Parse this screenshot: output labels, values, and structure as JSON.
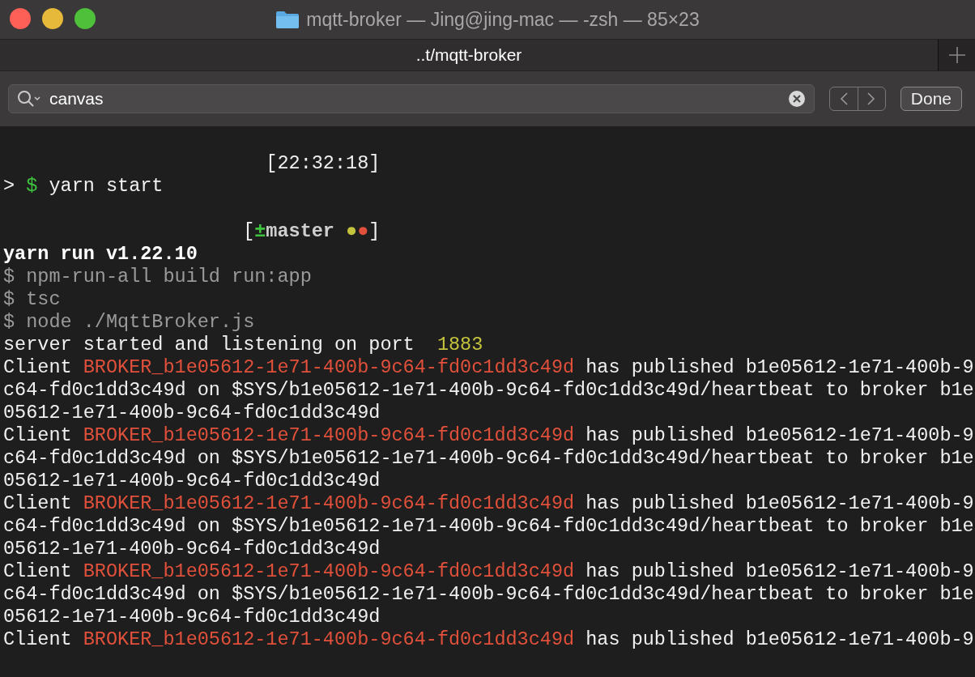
{
  "window": {
    "title": "mqtt-broker — Jing@jing-mac — -zsh — 85×23"
  },
  "tabs": [
    {
      "label": "..t/mqtt-broker",
      "selected": true
    }
  ],
  "find_bar": {
    "value": "canvas",
    "done_label": "Done"
  },
  "terminal_lines": [
    {
      "kind": "blank"
    },
    {
      "kind": "right_prompt",
      "segments": [
        {
          "text": "[22:32:18]",
          "color": "#f0f0f0",
          "bold": false
        }
      ]
    },
    {
      "kind": "line",
      "segments": [
        {
          "text": "> ",
          "color": "#f0f0f0",
          "bold": false
        },
        {
          "text": "$",
          "color": "#3fc43f",
          "bold": false
        },
        {
          "text": " yarn start",
          "color": "#f0f0f0",
          "bold": false
        }
      ]
    },
    {
      "kind": "blank"
    },
    {
      "kind": "git_prompt",
      "segments": [
        {
          "text": "[",
          "color": "#f0f0f0",
          "bold": false
        },
        {
          "text": "±",
          "color": "#3fc43f",
          "bold": true
        },
        {
          "text": "master ",
          "color": "#cfcfcf",
          "bold": true
        },
        {
          "text": "●",
          "color": "#c3c33d"
        },
        {
          "text": "●",
          "color": "#e0503a"
        },
        {
          "text": "]",
          "color": "#f0f0f0",
          "bold": false
        }
      ]
    },
    {
      "kind": "line",
      "segments": [
        {
          "text": "yarn run v1.22.10",
          "color": "#ffffff",
          "bold": true
        }
      ]
    },
    {
      "kind": "line",
      "segments": [
        {
          "text": "$ npm-run-all build run:app",
          "color": "#9a9a9a",
          "bold": false
        }
      ]
    },
    {
      "kind": "line",
      "segments": [
        {
          "text": "$ tsc",
          "color": "#9a9a9a",
          "bold": false
        }
      ]
    },
    {
      "kind": "line",
      "segments": [
        {
          "text": "$ node ./MqttBroker.js",
          "color": "#9a9a9a",
          "bold": false
        }
      ]
    },
    {
      "kind": "line",
      "segments": [
        {
          "text": "server started and listening on port  ",
          "color": "#f0f0f0",
          "bold": false
        },
        {
          "text": "1883",
          "color": "#c3c33d",
          "bold": false
        }
      ]
    },
    {
      "kind": "line",
      "segments": [
        {
          "text": "Client ",
          "color": "#f0f0f0",
          "bold": false
        },
        {
          "text": "BROKER_b1e05612-1e71-400b-9c64-fd0c1dd3c49d",
          "color": "#e0503a",
          "bold": false
        },
        {
          "text": " has published b1e05612-1e71-400b-9",
          "color": "#f0f0f0",
          "bold": false
        }
      ]
    },
    {
      "kind": "line",
      "segments": [
        {
          "text": "c64-fd0c1dd3c49d on $SYS/b1e05612-1e71-400b-9c64-fd0c1dd3c49d/heartbeat to broker b1e",
          "color": "#f0f0f0",
          "bold": false
        }
      ]
    },
    {
      "kind": "line",
      "segments": [
        {
          "text": "05612-1e71-400b-9c64-fd0c1dd3c49d",
          "color": "#f0f0f0",
          "bold": false
        }
      ]
    },
    {
      "kind": "line",
      "segments": [
        {
          "text": "Client ",
          "color": "#f0f0f0",
          "bold": false
        },
        {
          "text": "BROKER_b1e05612-1e71-400b-9c64-fd0c1dd3c49d",
          "color": "#e0503a",
          "bold": false
        },
        {
          "text": " has published b1e05612-1e71-400b-9",
          "color": "#f0f0f0",
          "bold": false
        }
      ]
    },
    {
      "kind": "line",
      "segments": [
        {
          "text": "c64-fd0c1dd3c49d on $SYS/b1e05612-1e71-400b-9c64-fd0c1dd3c49d/heartbeat to broker b1e",
          "color": "#f0f0f0",
          "bold": false
        }
      ]
    },
    {
      "kind": "line",
      "segments": [
        {
          "text": "05612-1e71-400b-9c64-fd0c1dd3c49d",
          "color": "#f0f0f0",
          "bold": false
        }
      ]
    },
    {
      "kind": "line",
      "segments": [
        {
          "text": "Client ",
          "color": "#f0f0f0",
          "bold": false
        },
        {
          "text": "BROKER_b1e05612-1e71-400b-9c64-fd0c1dd3c49d",
          "color": "#e0503a",
          "bold": false
        },
        {
          "text": " has published b1e05612-1e71-400b-9",
          "color": "#f0f0f0",
          "bold": false
        }
      ]
    },
    {
      "kind": "line",
      "segments": [
        {
          "text": "c64-fd0c1dd3c49d on $SYS/b1e05612-1e71-400b-9c64-fd0c1dd3c49d/heartbeat to broker b1e",
          "color": "#f0f0f0",
          "bold": false
        }
      ]
    },
    {
      "kind": "line",
      "segments": [
        {
          "text": "05612-1e71-400b-9c64-fd0c1dd3c49d",
          "color": "#f0f0f0",
          "bold": false
        }
      ]
    },
    {
      "kind": "line",
      "segments": [
        {
          "text": "Client ",
          "color": "#f0f0f0",
          "bold": false
        },
        {
          "text": "BROKER_b1e05612-1e71-400b-9c64-fd0c1dd3c49d",
          "color": "#e0503a",
          "bold": false
        },
        {
          "text": " has published b1e05612-1e71-400b-9",
          "color": "#f0f0f0",
          "bold": false
        }
      ]
    },
    {
      "kind": "line",
      "segments": [
        {
          "text": "c64-fd0c1dd3c49d on $SYS/b1e05612-1e71-400b-9c64-fd0c1dd3c49d/heartbeat to broker b1e",
          "color": "#f0f0f0",
          "bold": false
        }
      ]
    },
    {
      "kind": "line",
      "segments": [
        {
          "text": "05612-1e71-400b-9c64-fd0c1dd3c49d",
          "color": "#f0f0f0",
          "bold": false
        }
      ]
    },
    {
      "kind": "line",
      "segments": [
        {
          "text": "Client ",
          "color": "#f0f0f0",
          "bold": false
        },
        {
          "text": "BROKER_b1e05612-1e71-400b-9c64-fd0c1dd3c49d",
          "color": "#e0503a",
          "bold": false
        },
        {
          "text": " has published b1e05612-1e71-400b-9",
          "color": "#f0f0f0",
          "bold": false
        }
      ]
    }
  ]
}
